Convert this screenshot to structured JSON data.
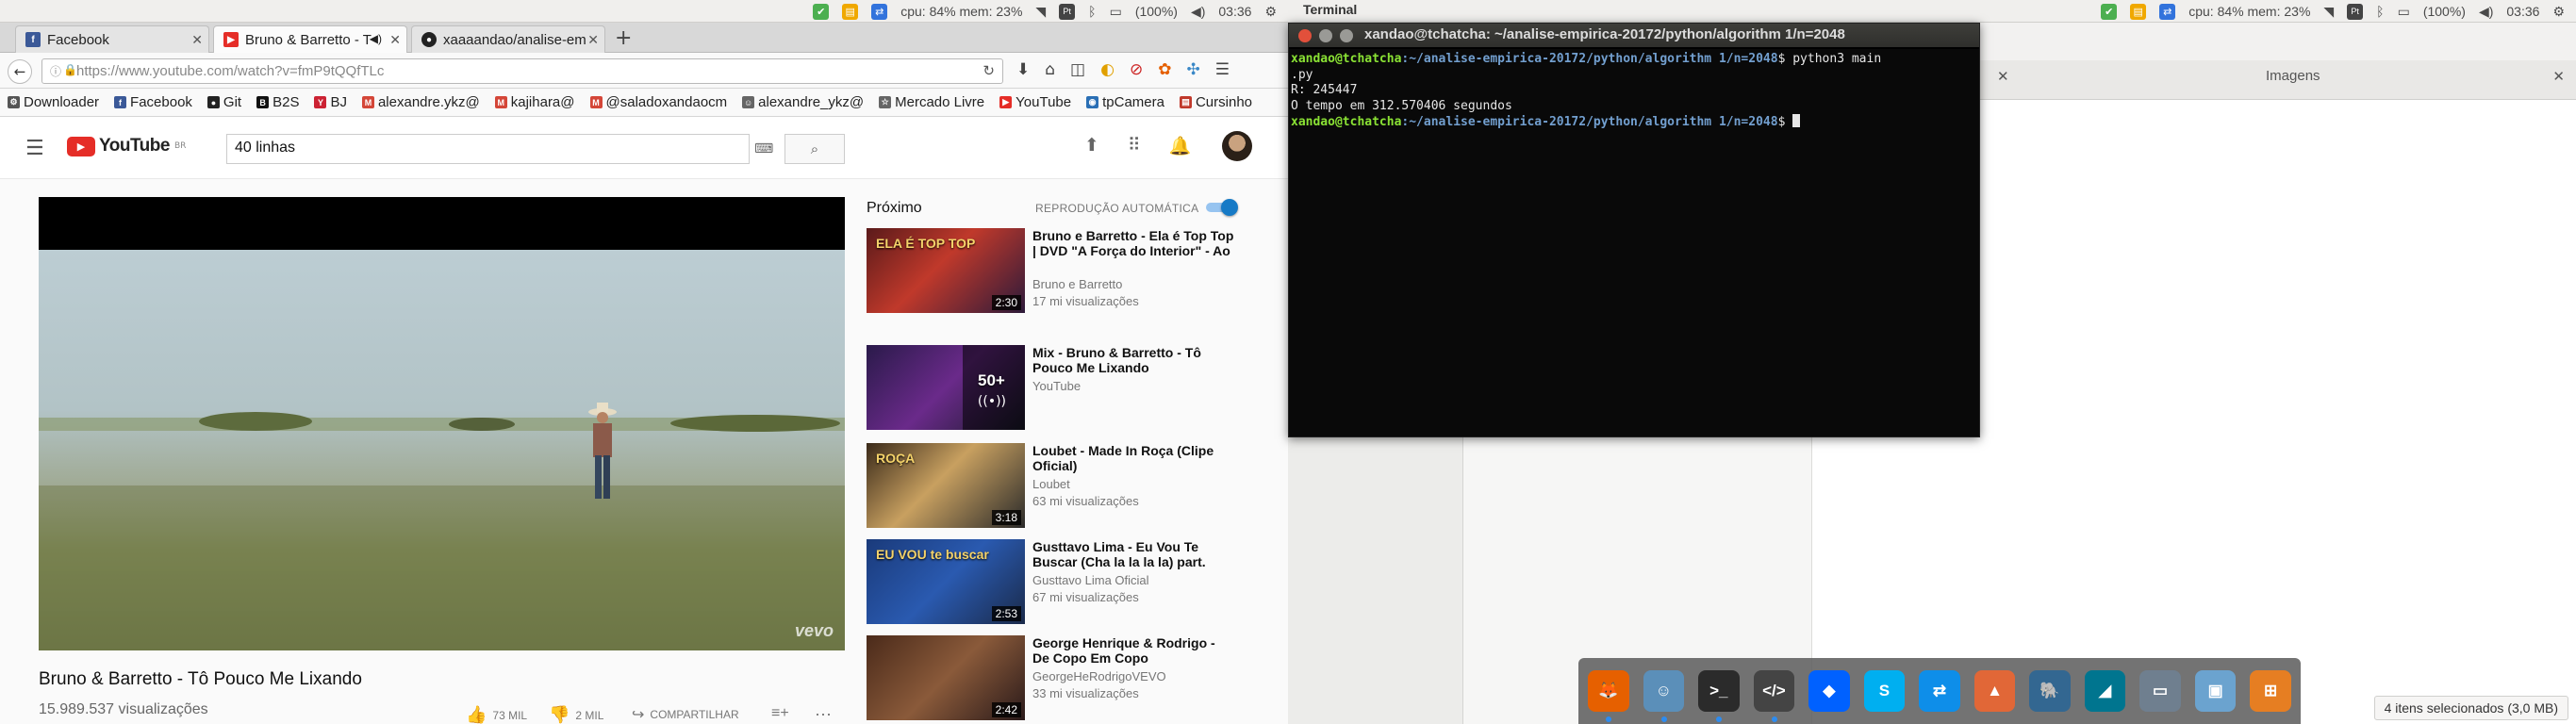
{
  "left_panel": {
    "app_title": "",
    "cpu_mem": "cpu: 84% mem: 23%",
    "battery": "(100%)",
    "clock": "03:36"
  },
  "right_panel": {
    "app_title": "Terminal",
    "cpu_mem": "cpu: 84% mem: 23%",
    "battery": "(100%)",
    "clock": "03:36"
  },
  "browser": {
    "tabs": [
      {
        "title": "Facebook",
        "icon": "facebook-icon",
        "color": "#3b5998"
      },
      {
        "title": "Bruno & Barretto - T",
        "icon": "youtube-icon",
        "color": "#e52d27",
        "active": true
      },
      {
        "title": "xaaaandao/analise-em",
        "icon": "github-icon",
        "color": "#222222"
      }
    ],
    "new_tab": "+",
    "url": "https://www.youtube.com/watch?v=fmP9tQQfTLc",
    "bookmarks": [
      {
        "label": "Downloader",
        "icon": "gear-icon",
        "color": "#555555"
      },
      {
        "label": "Facebook",
        "icon": "facebook-icon",
        "color": "#3b5998"
      },
      {
        "label": "Git",
        "icon": "github-icon",
        "color": "#222222"
      },
      {
        "label": "B2S",
        "icon": "b2s-icon",
        "color": "#111111"
      },
      {
        "label": "BJ",
        "icon": "bj-icon",
        "color": "#cc2233"
      },
      {
        "label": "alexandre.ykz@",
        "icon": "gmail-icon",
        "color": "#d44638"
      },
      {
        "label": "kajihara@",
        "icon": "gmail-icon",
        "color": "#d44638"
      },
      {
        "label": "@saladoxandaocm",
        "icon": "gmail-icon",
        "color": "#d44638"
      },
      {
        "label": "alexandre_ykz@",
        "icon": "user-icon",
        "color": "#666666"
      },
      {
        "label": "Mercado Livre",
        "icon": "bookmark-icon",
        "color": "#666666"
      },
      {
        "label": "YouTube",
        "icon": "youtube-icon",
        "color": "#e52d27"
      },
      {
        "label": "tpCamera",
        "icon": "camera-icon",
        "color": "#2a6fb5"
      },
      {
        "label": "Cursinho",
        "icon": "book-icon",
        "color": "#c0392b"
      }
    ]
  },
  "youtube": {
    "logo": "YouTube",
    "logo_region": "BR",
    "search_value": "40 linhas",
    "video_title": "Bruno & Barretto - Tô Pouco Me Lixando",
    "views": "15.989.537 visualizações",
    "likes": "73 MIL",
    "dislikes": "2 MIL",
    "share": "COMPARTILHAR",
    "watermark": "vevo",
    "up_next": "Próximo",
    "autoplay": "REPRODUÇÃO AUTOMÁTICA",
    "autoplay_on": true,
    "recommendations": [
      {
        "title": "Bruno e Barretto - Ela é Top Top | DVD \"A Força do Interior\" - Ao",
        "channel": "Bruno e Barretto",
        "views": "17 mi visualizações",
        "duration": "2:30",
        "thumb_text": "ELA É TOP TOP"
      },
      {
        "title": "Mix - Bruno & Barretto - Tô Pouco Me Lixando",
        "channel": "YouTube",
        "views": "",
        "duration": "",
        "thumb_text": "50+"
      },
      {
        "title": "Loubet - Made In Roça (Clipe Oficial)",
        "channel": "Loubet",
        "views": "63 mi visualizações",
        "duration": "3:18",
        "thumb_text": "ROÇA"
      },
      {
        "title": "Gusttavo Lima - Eu Vou Te Buscar (Cha la la la la) part.",
        "channel": "Gusttavo Lima Oficial",
        "views": "67 mi visualizações",
        "duration": "2:53",
        "thumb_text": "EU VOU te buscar"
      },
      {
        "title": "George Henrique & Rodrigo - De Copo Em Copo",
        "channel": "GeorgeHeRodrigoVEVO",
        "views": "33 mi visualizações",
        "duration": "2:42",
        "thumb_text": ""
      }
    ]
  },
  "terminal": {
    "title": "xandao@tchatcha: ~/analise-empirica-20172/python/algorithm 1/n=2048",
    "prompt_user": "xandao@tchatcha",
    "prompt_path": ":~/analise-empirica-20172/python/algorithm 1/n=2048",
    "prompt_sign": "$",
    "command": " python3 main",
    "command_wrap": ".py",
    "output_1": "R: 245447",
    "output_2": "O tempo em 312.570406 segundos"
  },
  "file_manager": {
    "tab_label": "Imagens",
    "status": "4 itens selecionados (3,0 MB)"
  },
  "dock": [
    {
      "name": "firefox",
      "color": "#e66000",
      "glyph": "🦊"
    },
    {
      "name": "files",
      "color": "#5b8fb9",
      "glyph": "☺"
    },
    {
      "name": "terminal",
      "color": "#2b2b2b",
      "glyph": ">_"
    },
    {
      "name": "editor",
      "color": "#444444",
      "glyph": "</>"
    },
    {
      "name": "dropbox",
      "color": "#0061ff",
      "glyph": "◆"
    },
    {
      "name": "skype",
      "color": "#00aff0",
      "glyph": "S"
    },
    {
      "name": "teamviewer",
      "color": "#0e8ee9",
      "glyph": "⇄"
    },
    {
      "name": "matlab",
      "color": "#e16737",
      "glyph": "▲"
    },
    {
      "name": "postgres",
      "color": "#336791",
      "glyph": "🐘"
    },
    {
      "name": "mysql-workbench",
      "color": "#00758f",
      "glyph": "◢"
    },
    {
      "name": "scanner",
      "color": "#6f7f8f",
      "glyph": "▭"
    },
    {
      "name": "virtualbox",
      "color": "#6ba3cf",
      "glyph": "▣"
    },
    {
      "name": "network",
      "color": "#e67e22",
      "glyph": "⊞"
    }
  ]
}
